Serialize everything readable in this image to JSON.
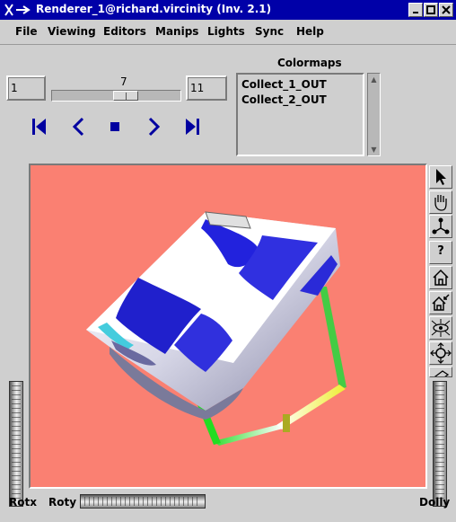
{
  "window": {
    "title": "Renderer_1@richard.vircinity (Inv. 2.1)",
    "buttons": [
      "minimize",
      "maximize",
      "close"
    ]
  },
  "menu": [
    "File",
    "Viewing",
    "Editors",
    "Manips",
    "Lights",
    "Sync",
    "Help"
  ],
  "timestep": {
    "min_value": "1",
    "max_value": "11",
    "current_value": "7"
  },
  "playback": [
    "step-back",
    "reverse",
    "stop",
    "forward",
    "step-forward"
  ],
  "colormaps": {
    "label": "Colormaps",
    "items": [
      "Collect_1_OUT",
      "Collect_2_OUT"
    ]
  },
  "viewer": {
    "background_color": "#fa8072",
    "right_toolbar": [
      "pick-arrow-icon",
      "hand-icon",
      "axes-icon",
      "help-icon",
      "home-icon",
      "set-home-icon",
      "view-all-icon",
      "seek-icon",
      "perspective-icon"
    ],
    "help_glyph": "?"
  },
  "bottom": {
    "rotx_label": "Rotx",
    "roty_label": "Roty",
    "dolly_label": "Dolly"
  }
}
